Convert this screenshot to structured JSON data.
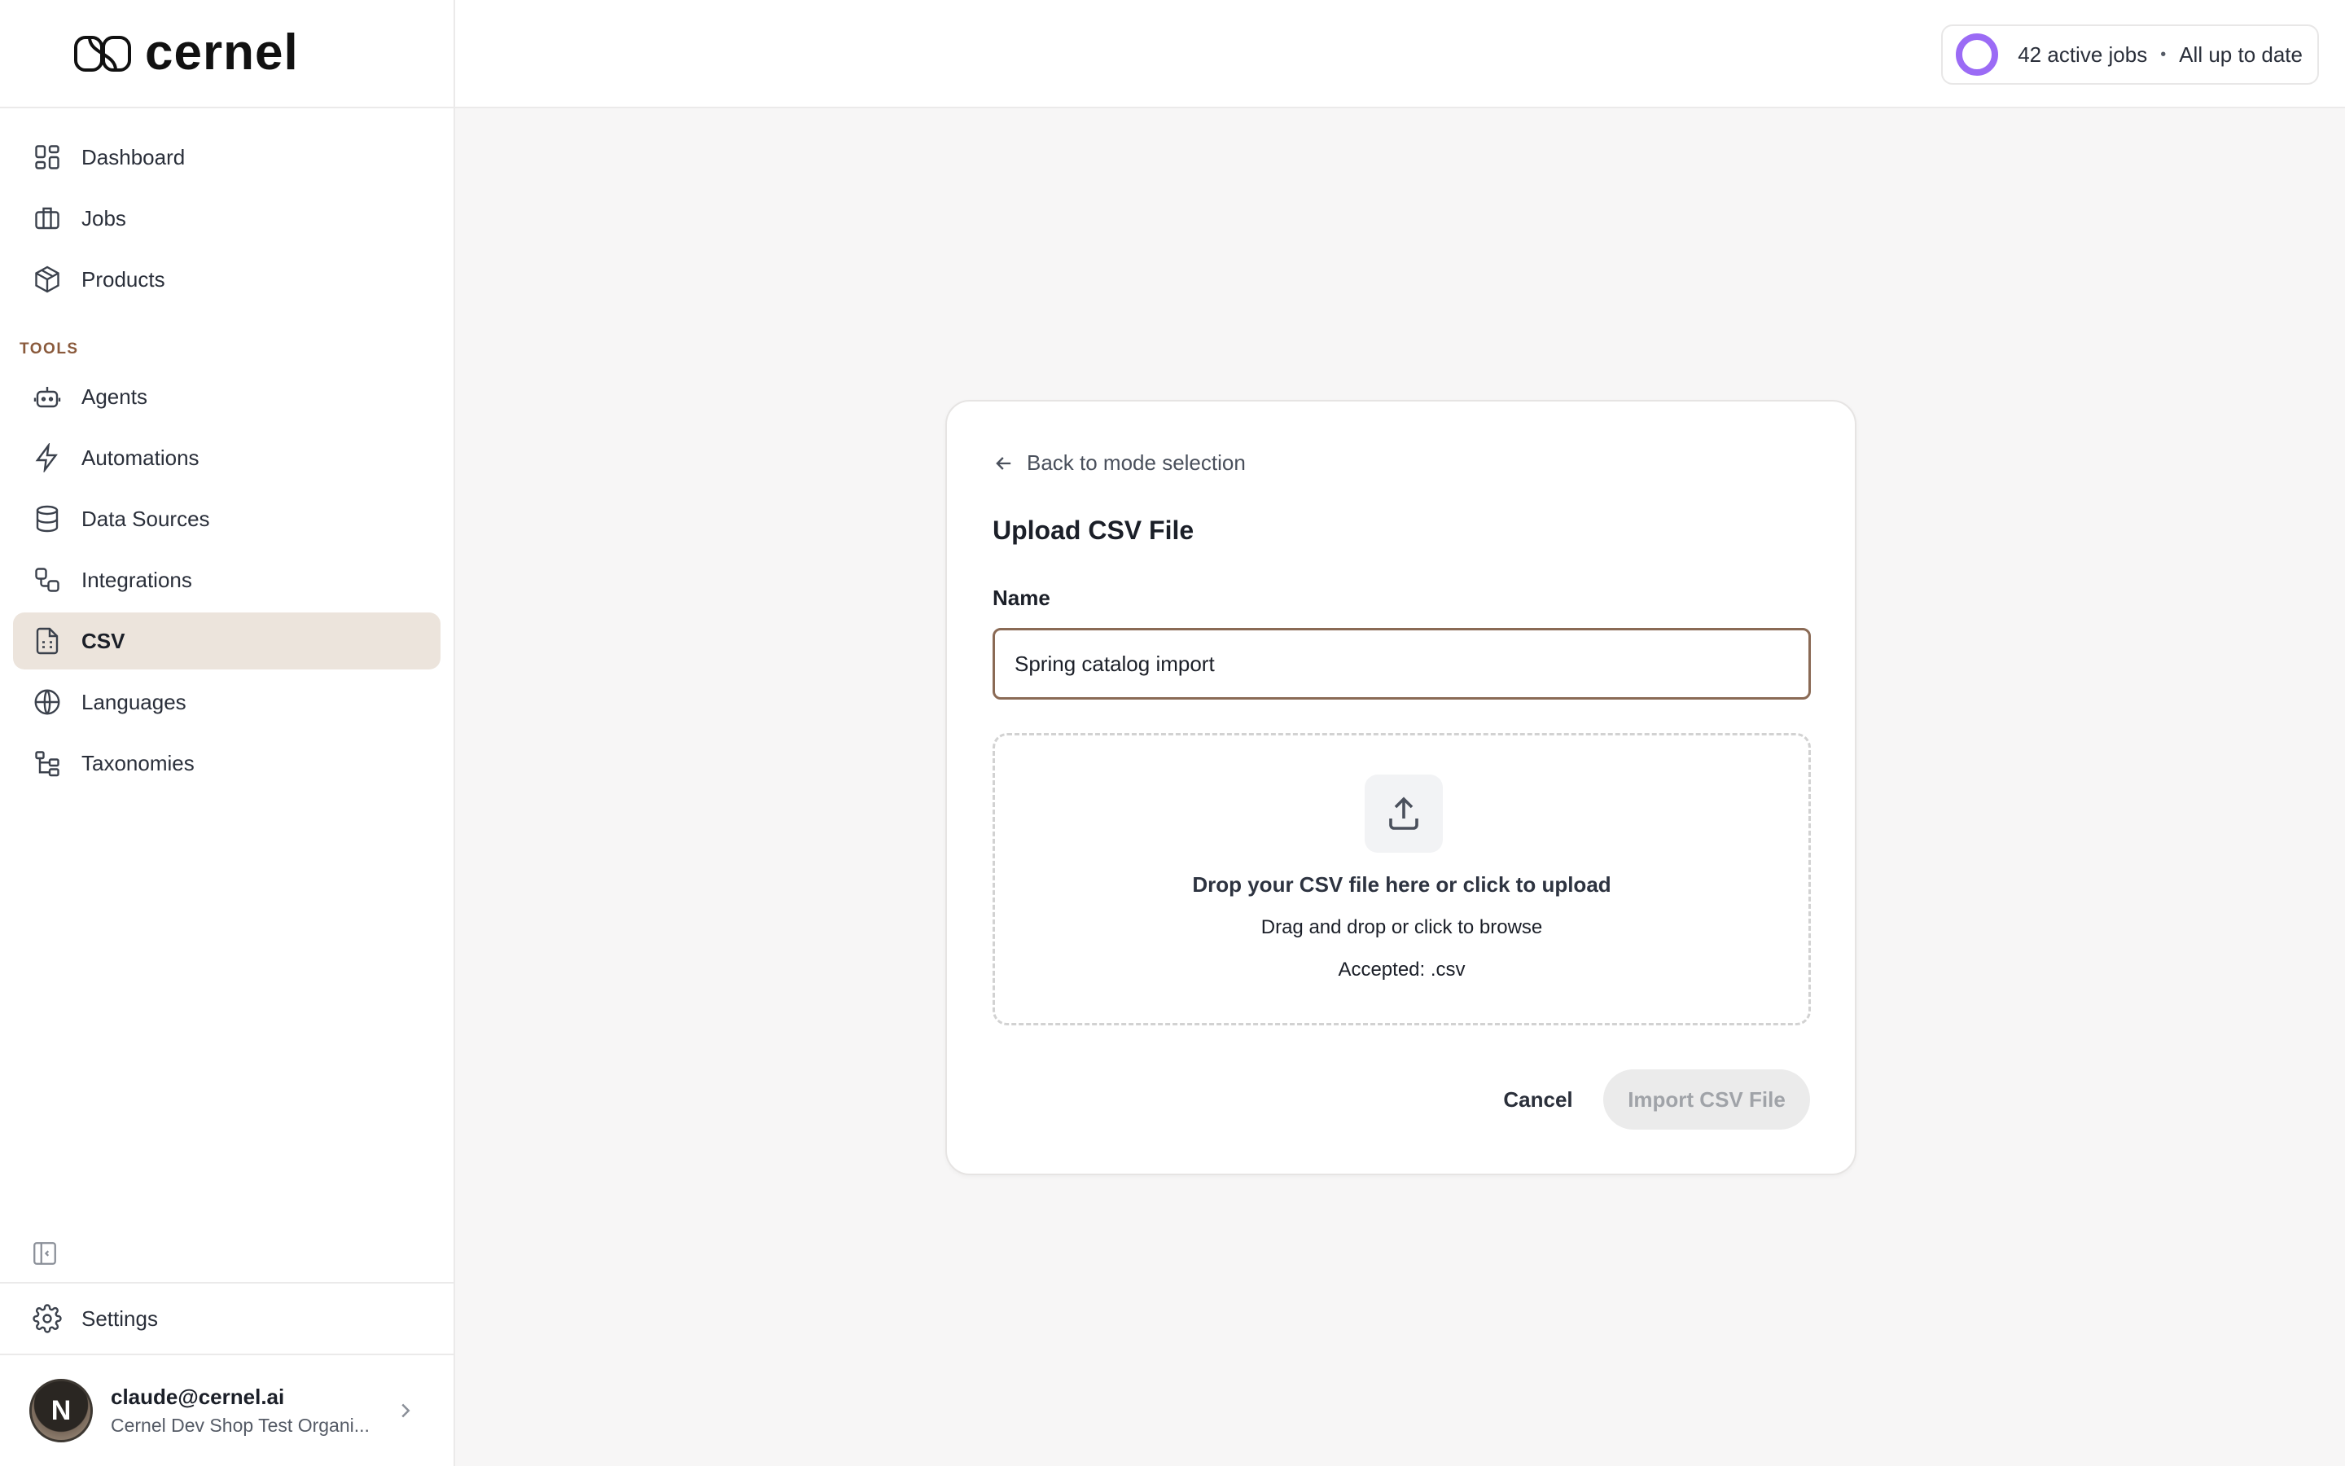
{
  "brand": {
    "name": "cernel"
  },
  "sidebar": {
    "nav": [
      {
        "label": "Dashboard",
        "icon": "dashboard-icon"
      },
      {
        "label": "Jobs",
        "icon": "briefcase-icon"
      },
      {
        "label": "Products",
        "icon": "package-icon"
      }
    ],
    "section_label": "TOOLS",
    "tools": [
      {
        "label": "Agents",
        "icon": "bot-icon"
      },
      {
        "label": "Automations",
        "icon": "lightning-icon"
      },
      {
        "label": "Data Sources",
        "icon": "database-icon"
      },
      {
        "label": "Integrations",
        "icon": "integrations-icon"
      },
      {
        "label": "CSV",
        "icon": "csv-file-icon",
        "active": true
      },
      {
        "label": "Languages",
        "icon": "globe-icon"
      },
      {
        "label": "Taxonomies",
        "icon": "tree-icon"
      }
    ],
    "settings_label": "Settings",
    "user": {
      "initial": "N",
      "email": "claude@cernel.ai",
      "org": "Cernel Dev Shop Test Organi..."
    }
  },
  "topbar": {
    "status_jobs": "42 active jobs",
    "status_separator": "•",
    "status_state": "All up to date",
    "status_ring_color": "#9b6bf5"
  },
  "card": {
    "back_label": "Back to mode selection",
    "title": "Upload CSV File",
    "name_label": "Name",
    "name_value": "Spring catalog import",
    "dropzone": {
      "title": "Drop your CSV file here or click to upload",
      "subtitle": "Drag and drop or click to browse",
      "accepted": "Accepted: .csv"
    },
    "cancel_label": "Cancel",
    "import_label": "Import CSV File"
  },
  "colors": {
    "accent_active_bg": "#ece4dc",
    "section_label": "#8a5a3c",
    "input_border": "#8a6a55"
  }
}
